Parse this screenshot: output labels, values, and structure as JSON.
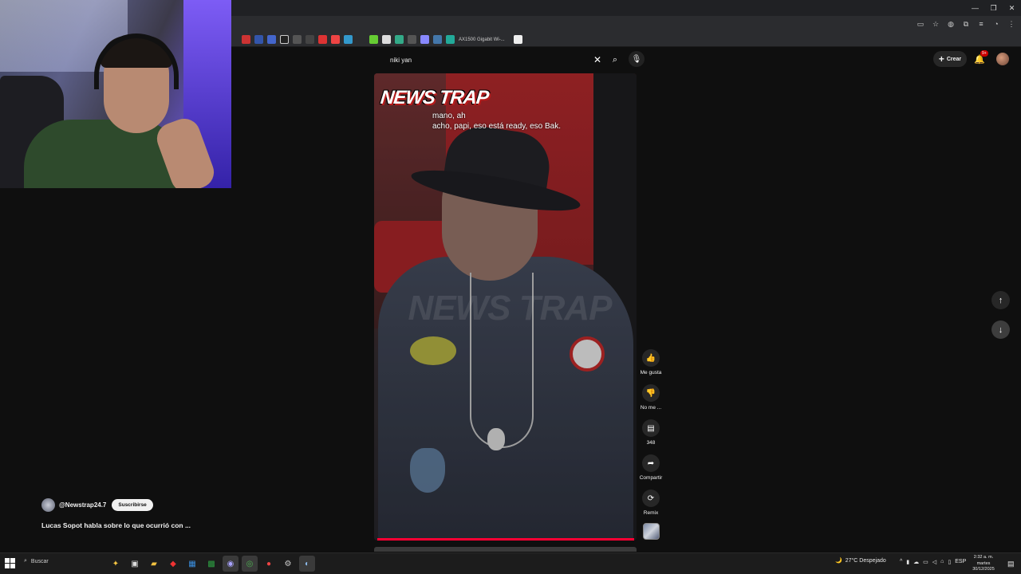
{
  "window": {
    "minimize": "—",
    "restore": "❐",
    "close": "✕"
  },
  "bookmarks": {
    "item_label": "AX1500 Gigabit Wi-..."
  },
  "search": {
    "query": "niki yan",
    "clear_icon": "close-icon",
    "search_icon": "search-icon"
  },
  "header": {
    "create_label": "Crear",
    "notifications_badge": "9+"
  },
  "video": {
    "logo_text": "NEWS TRAP",
    "watermark_text": "NEWS TRAP",
    "caption_line1": "mano, ah",
    "caption_line2": "acho, papi, eso está ready, eso Bak."
  },
  "actions": {
    "like_label": "Me gusta",
    "dislike_label": "No me ...",
    "comments_count": "348",
    "share_label": "Compartir",
    "remix_label": "Remix"
  },
  "channel": {
    "handle": "@Newstrap24.7",
    "subscribe_label": "Suscribirse",
    "title": "Lucas Sopot habla sobre lo que ocurrió con ..."
  },
  "taskbar": {
    "search_label": "Buscar",
    "weather": "27°C  Despejado",
    "language": "ESP",
    "time": "2:32 a. m.",
    "day": "martes",
    "date": "30/12/2025"
  },
  "colors": {
    "accent": "#ff0033",
    "subscribe_bg": "#f1f1f1",
    "page_bg": "#0f0f0f"
  }
}
